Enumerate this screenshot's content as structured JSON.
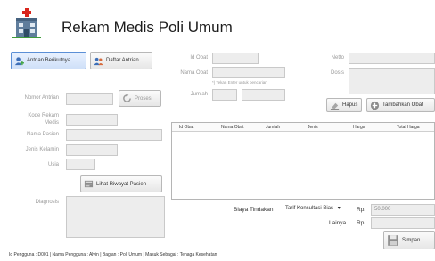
{
  "header": {
    "title": "Rekam Medis Poli Umum",
    "logo_icon": "hospital-icon"
  },
  "top_buttons": {
    "antrian_berikutnya": "Antrian Berikutnya",
    "daftar_antrian": "Daftar Antrian"
  },
  "patient": {
    "nomor_antrian_label": "Nomor Antrian",
    "proses_label": "Proses",
    "kode_rekam_medis_label_1": "Kode Rekam",
    "kode_rekam_medis_label_2": "Medis",
    "nama_pasien_label": "Nama Pasien",
    "jenis_kelamin_label": "Jenis Kelamin",
    "usia_label": "Usia",
    "lihat_riwayat_label": "Lihat Riwayat Pasien",
    "diagnosis_label": "Diagnosis"
  },
  "obat": {
    "id_obat_label": "Id Obat",
    "nama_obat_label": "Nama Obat",
    "hint": "*) Tekan Enter untuk pencarian",
    "jumlah_label": "Jumlah",
    "netto_label": "Netto",
    "dosis_label": "Dosis",
    "hapus_label": "Hapus",
    "tambahkan_label": "Tambahkan Obat"
  },
  "table": {
    "columns": [
      "Id Obat",
      "Nama Obat",
      "Jumlah",
      "Jenis",
      "Harga",
      "Total Harga"
    ],
    "rows": []
  },
  "billing": {
    "biaya_label": "Biaya Tindakan",
    "tarif_selected": "Tarif Konsultasi Bias",
    "rp1": "Rp.",
    "biaya_value": "50.000",
    "lainnya_label": "Lainya",
    "rp2": "Rp.",
    "simpan_label": "Simpan"
  },
  "status_bar": "Id Pengguna :  D001  | Nama Pengguna :  Alvin  | Bagian :  Poli Umum  | Masuk Sebagai :  Tenaga Kesehatan"
}
